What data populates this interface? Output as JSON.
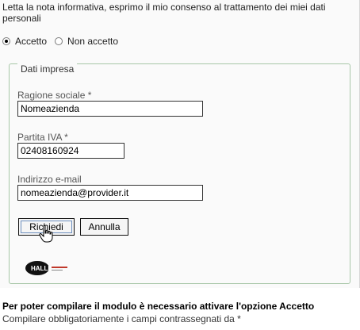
{
  "consent": {
    "text": "Letta la nota informativa, esprimo il mio consenso al trattamento dei miei dati personali",
    "options": [
      {
        "label": "Accetto",
        "checked": true
      },
      {
        "label": "Non accetto",
        "checked": false
      }
    ]
  },
  "company_section": {
    "legend": "Dati impresa",
    "fields": {
      "ragione_sociale": {
        "label": "Ragione sociale *",
        "value": "Nomeazienda"
      },
      "partita_iva": {
        "label": "Partita IVA *",
        "value": "02408160924"
      },
      "email": {
        "label": "Indirizzo e-mail",
        "value": "nomeazienda@provider.it"
      }
    },
    "buttons": {
      "submit": "Richiedi",
      "cancel": "Annulla"
    },
    "logo_text": "HALLEY"
  },
  "footer": {
    "notice": "Per poter compilare il modulo è necessario attivare l'opzione Accetto",
    "required_hint": "Compilare obbligatoriamente i campi contrassegnati da *"
  },
  "colors": {
    "fieldset_border": "#a8c7a8",
    "button_focus": "#6d8fbf"
  },
  "icons": {
    "cursor": "hand-pointer-icon",
    "logo": "halley-logo"
  }
}
